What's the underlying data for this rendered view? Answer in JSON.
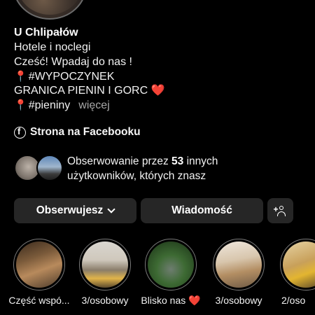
{
  "profile": {
    "name": "U Chlipałów",
    "bio_lines": [
      "Hotele i noclegi",
      "Cześć! Wpadaj do nas !",
      "#WYPOCZYNEK",
      "GRANICA PIENIN I GORC",
      "#pieniny"
    ],
    "more_label": "więcej",
    "heart": "❤️"
  },
  "facebook_link": {
    "label": "Strona na Facebooku"
  },
  "followers": {
    "text_before": "Obserwowanie przez ",
    "count": "53",
    "text_after": " innych użytkowników, których znasz"
  },
  "actions": {
    "follow_label": "Obserwujesz",
    "message_label": "Wiadomość"
  },
  "highlights": [
    {
      "label": "Część wspó..."
    },
    {
      "label": "3/osobowy"
    },
    {
      "label": "Blisko nas ❤️"
    },
    {
      "label": "3/osobowy"
    },
    {
      "label": "2/oso"
    }
  ],
  "colors": {
    "background": "#000000",
    "button": "#262626",
    "muted_text": "#a8a8a8",
    "pin": "#e0245e",
    "heart": "#f0213c"
  }
}
